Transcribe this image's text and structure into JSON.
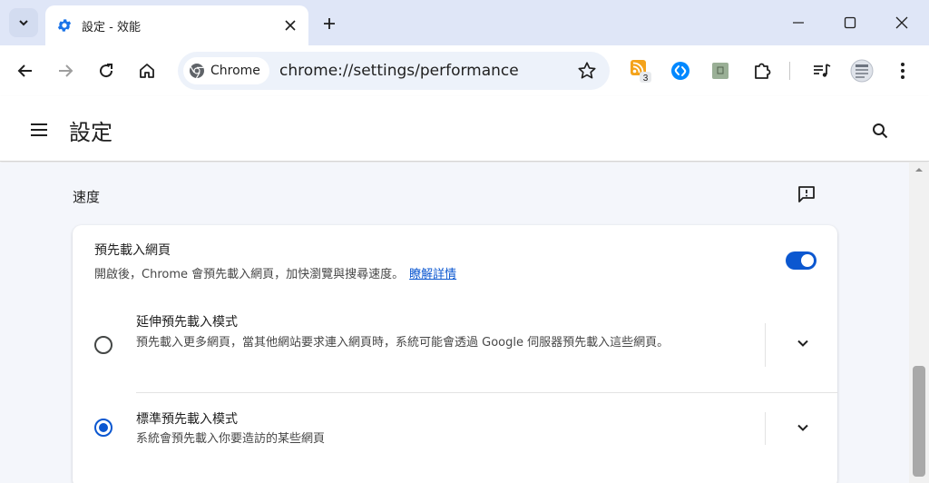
{
  "tab": {
    "title": "設定 - 效能"
  },
  "window_controls": [
    "minimize-icon",
    "maximize-icon",
    "close-icon"
  ],
  "omnibox": {
    "chip_label": "Chrome",
    "url": "chrome://settings/performance"
  },
  "extensions": {
    "rss_badge": "3"
  },
  "header": {
    "title": "設定"
  },
  "section": {
    "title": "速度"
  },
  "preload": {
    "title": "預先載入網頁",
    "description": "開啟後，Chrome 會預先載入網頁，加快瀏覽與搜尋速度。",
    "link": "瞭解詳情",
    "enabled": true
  },
  "options": [
    {
      "title": "延伸預先載入模式",
      "description": "預先載入更多網頁，當其他網站要求連入網頁時，系統可能會透過 Google 伺服器預先載入這些網頁。",
      "selected": false
    },
    {
      "title": "標準預先載入模式",
      "description": "系統會預先載入你要造訪的某些網頁",
      "selected": true
    }
  ],
  "colors": {
    "accent": "#0b57d0",
    "tabstrip": "#dfe6f7",
    "content_bg": "#f4f6fb"
  }
}
